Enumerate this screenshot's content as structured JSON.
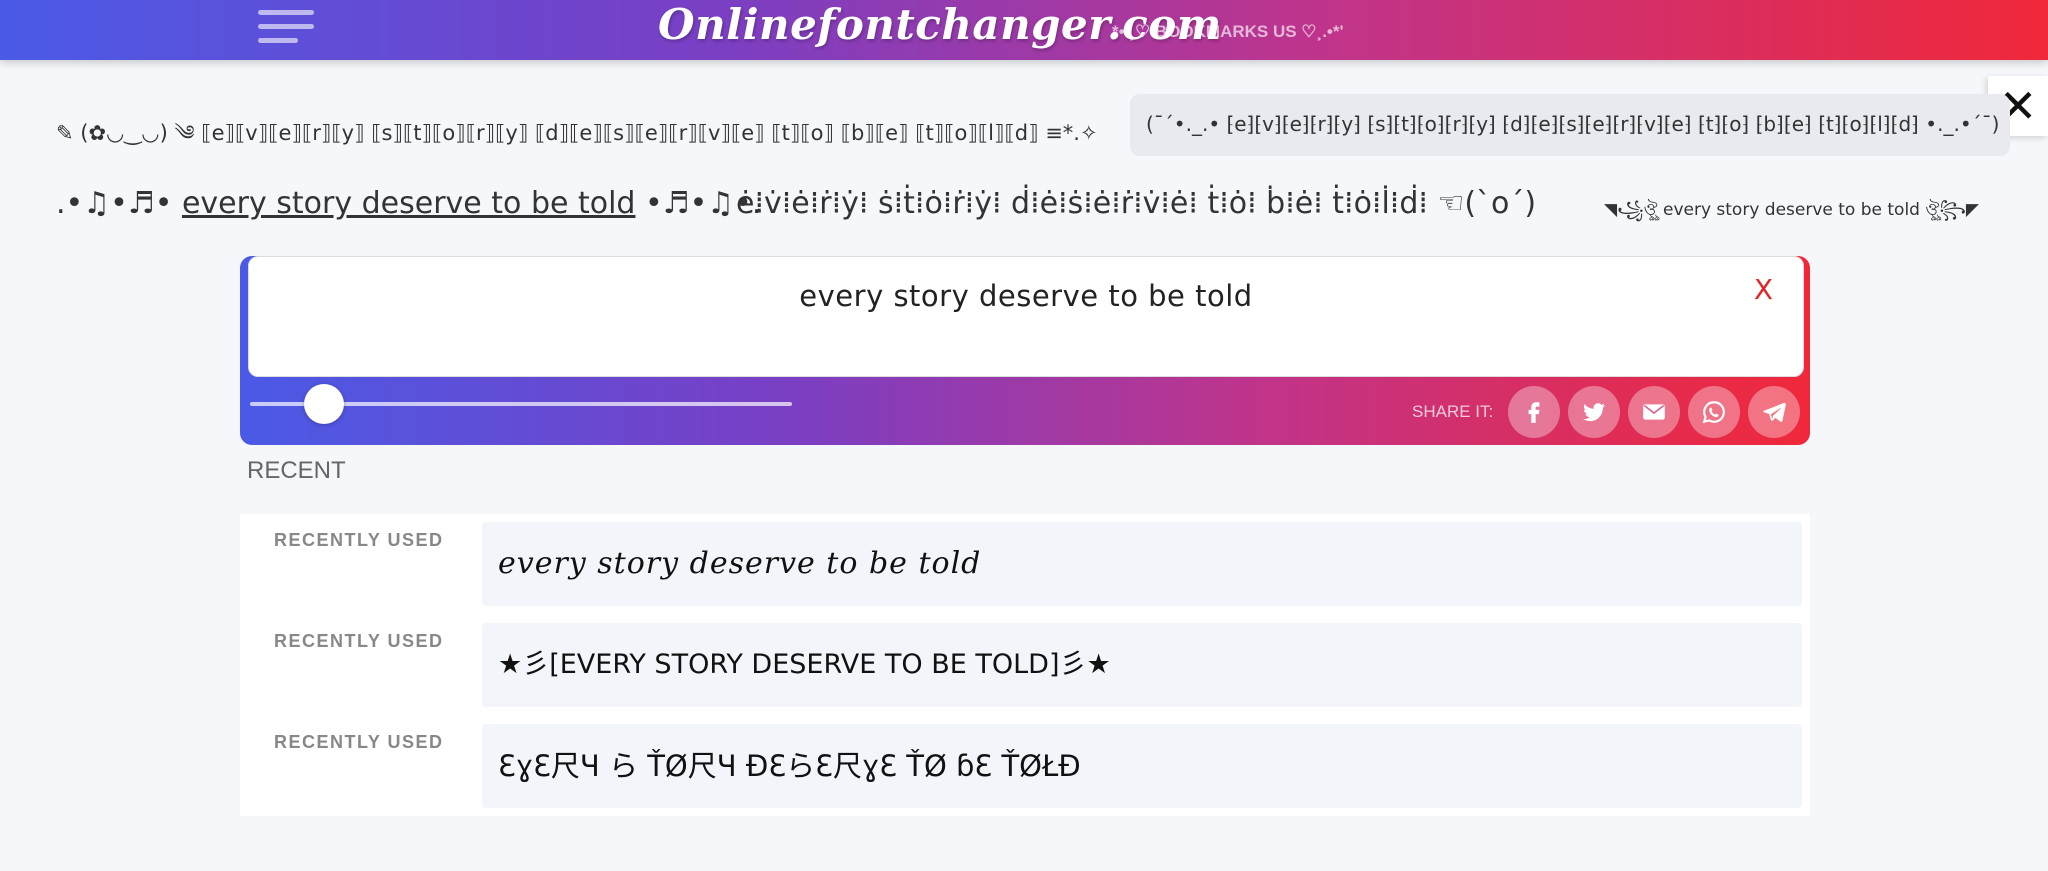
{
  "header": {
    "site_title": "Onlinefontchanger.com",
    "bookmark_text": "*•.¸♡ BOOKMARKS US ♡¸.•*'"
  },
  "close_glyph": "✕",
  "styled_results": {
    "row1_left": "✎ (✿◡‿◡) ༄ ⟦e⟧⟦v⟧⟦e⟧⟦r⟧⟦y⟧ ⟦s⟧⟦t⟧⟦o⟧⟦r⟧⟦y⟧ ⟦d⟧⟦e⟧⟦s⟧⟦e⟧⟦r⟧⟦v⟧⟦e⟧ ⟦t⟧⟦o⟧ ⟦b⟧⟦e⟧ ⟦t⟧⟦o⟧⟦l⟧⟦d⟧ ≡*.✧",
    "row1_right": "(¯´•._.• ⁅e⁆⁅v⁆⁅e⁆⁅r⁆⁅y⁆ ⁅s⁆⁅t⁆⁅o⁆⁅r⁆⁅y⁆ ⁅d⁆⁅e⁆⁅s⁆⁅e⁆⁅r⁆⁅v⁆⁅e⁆ ⁅t⁆⁅o⁆ ⁅b⁆⁅e⁆ ⁅t⁆⁅o⁆⁅l⁆⁅d⁆ •._.•´¯)",
    "row2_a_prefix": ".•♫•♬• ",
    "row2_a_main": "every story deserve to be told",
    "row2_a_suffix": " •♬•♫•.",
    "row2_b": "ė⁞v̇⁞ė⁞ṙ⁞ẏ⁞ ṡ⁞ṫ⁞ȯ⁞ṙ⁞ẏ⁞ ḋ⁞ė⁞ṡ⁞ė⁞ṙ⁞v̇⁞ė⁞ ṫ⁞ȯ⁞ ḃ⁞ė⁞ ṫ⁞ȯ⁞l̇⁞ḋ⁞ ☜(`o´)",
    "row2_c": "◥꧁ঔৣ every story deserve to be told ঔৣ꧂◤"
  },
  "editor": {
    "text": "every story deserve to be told",
    "clear_label": "X",
    "slider_value": 0.1,
    "share_label": "SHARE IT:",
    "share_icons": [
      "facebook-icon",
      "twitter-icon",
      "mail-icon",
      "whatsapp-icon",
      "telegram-icon"
    ]
  },
  "recent": {
    "title": "RECENT",
    "items": [
      {
        "label": "RECENTLY USED",
        "text": "every story deserve to be told"
      },
      {
        "label": "RECENTLY USED",
        "text": "★彡[EVERY STORY DESERVE TO BE TOLD]彡★"
      },
      {
        "label": "RECENTLY USED",
        "text": "ƐɣƐ尺Ч ら ŤØ尺Ч ĐƐらƐ尺ɣƐ ŤØ ɓƐ ŤØŁĐ"
      }
    ]
  },
  "colors": {
    "gradient_start": "#4a5ae6",
    "gradient_mid": "#c0348a",
    "gradient_end": "#f0283a",
    "clear_x": "#e02828"
  }
}
